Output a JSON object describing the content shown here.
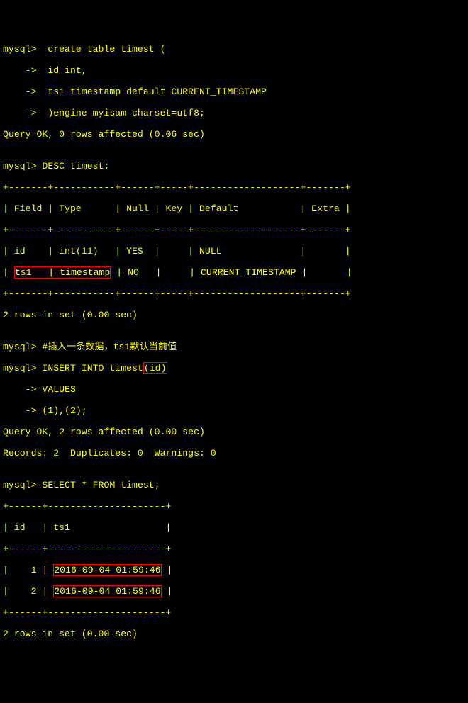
{
  "lines": {
    "l1_prompt": "mysql>  ",
    "l1_text": "create table timest (",
    "l2_prompt": "    ->  ",
    "l2_text": "id int,",
    "l3_prompt": "    ->  ",
    "l3_text": "ts1 timestamp default CURRENT_TIMESTAMP",
    "l4_prompt": "    ->  ",
    "l4_text": ")engine myisam charset=utf8;",
    "l5": "Query OK, 0 rows affected (0.06 sec)",
    "l6": "",
    "l7_prompt": "mysql> ",
    "l7_text": "DESC timest;",
    "l8": "+-------+-----------+------+-----+-------------------+-------+",
    "l9": "| Field | Type      | Null | Key | Default           | Extra |",
    "l10": "+-------+-----------+------+-----+-------------------+-------+",
    "l11": "| id    | int(11)   | YES  |     | NULL              |       |",
    "l12a": "| ",
    "l12_hl": "ts1   | timestamp",
    "l12b": " | NO   |     | CURRENT_TIMESTAMP |       |",
    "l13": "+-------+-----------+------+-----+-------------------+-------+",
    "l14": "2 rows in set (0.00 sec)",
    "l15": "",
    "l16_prompt": "mysql> ",
    "l16_text": "#插入一条数据，ts1默认当前值",
    "l17_prompt": "mysql> ",
    "l17_text_a": "INSERT INTO timest",
    "l17_hl": "(id)",
    "l18_prompt": "    -> ",
    "l18_text": "VALUES",
    "l19_prompt": "    -> ",
    "l19_text": "(1),(2);",
    "l20": "Query OK, 2 rows affected (0.00 sec)",
    "l21": "Records: 2  Duplicates: 0  Warnings: 0",
    "l22": "",
    "l23_prompt": "mysql> ",
    "l23_text": "SELECT * FROM timest;",
    "l24": "+------+---------------------+",
    "l25": "| id   | ts1                 |",
    "l26": "+------+---------------------+",
    "l27a": "|    1 | ",
    "l27_hl": "2016-09-04 01:59:46",
    "l27b": " |",
    "l28a": "|    2 | ",
    "l28_hl": "2016-09-04 01:59:46",
    "l28b": " |",
    "l29": "+------+---------------------+",
    "l30": "2 rows in set (0.00 sec)",
    "l31": ""
  }
}
